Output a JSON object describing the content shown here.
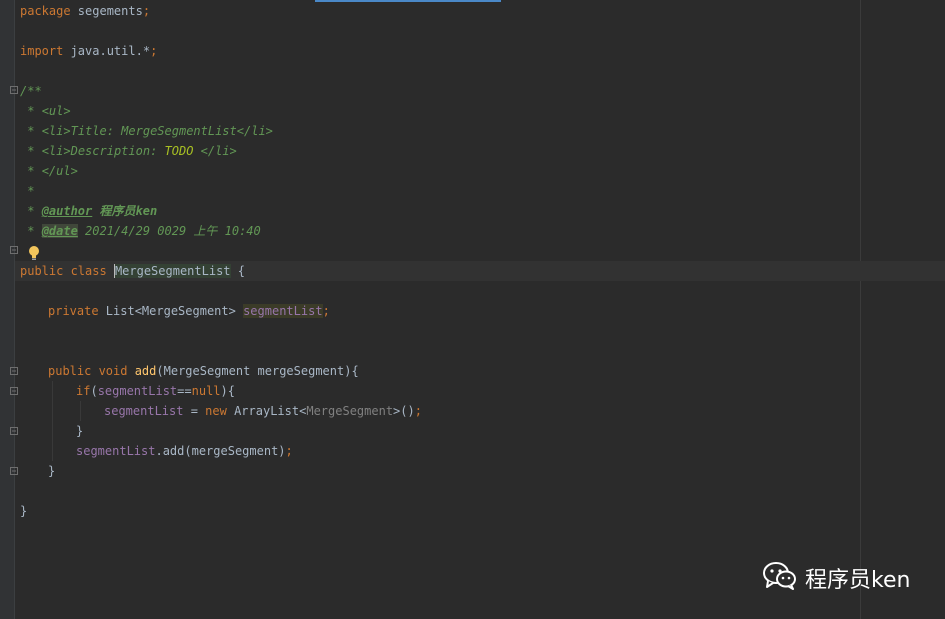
{
  "code": {
    "package_kw": "package",
    "package_name": " segements",
    "semicolon": ";",
    "import_kw": "import",
    "import_path": " java.util.*",
    "doc_open": "/**",
    "doc_ul_open_prefix": " * ",
    "doc_ul_open": "<ul>",
    "doc_li_title_prefix": " * ",
    "doc_li_title_open": "<li>",
    "doc_li_title_text": "Title: MergeSegmentList",
    "doc_li_title_close": "</li>",
    "doc_li_desc_prefix": " * ",
    "doc_li_desc_open": "<li>",
    "doc_li_desc_text": "Description: ",
    "doc_li_desc_todo": "TODO",
    "doc_li_desc_space": " ",
    "doc_li_desc_close": "</li>",
    "doc_ul_close_prefix": " * ",
    "doc_ul_close": "</ul>",
    "doc_blank": " *",
    "doc_author_prefix": " * ",
    "doc_author_tag": "@author",
    "doc_author_value": " 程序员ken",
    "doc_date_prefix": " * ",
    "doc_date_tag": "@date",
    "doc_date_value": " 2021/4/29 0029 上午 10:40",
    "public_kw": "public",
    "class_kw": " class ",
    "class_name": "MergeSegmentList",
    "class_brace": " {",
    "private_kw": "private",
    "list_type": " List<MergeSegment> ",
    "field_name": "segmentList",
    "public_void": "public void ",
    "method_name": "add",
    "method_params": "(MergeSegment mergeSegment){",
    "if_kw": "if",
    "if_open": "(",
    "if_field": "segmentList",
    "if_eq": "==",
    "null_kw": "null",
    "if_close": "){",
    "assign_field": "segmentList",
    "assign_op": " = ",
    "new_kw": "new",
    "arraylist": " ArrayList<",
    "arraylist_generic": "MergeSegment",
    "arraylist_close": ">()",
    "close_brace": "}",
    "call_field": "segmentList",
    "call_rest": ".add(mergeSegment)",
    "method_close": "}",
    "class_close": "}"
  },
  "watermark": {
    "text": "程序员ken",
    "icon": "wechat-icon"
  },
  "colors": {
    "background": "#2b2b2b",
    "keyword": "#cc7832",
    "field": "#9876aa",
    "method": "#ffc66d",
    "doc": "#629755",
    "todo": "#a8c023",
    "text": "#a9b7c6"
  }
}
